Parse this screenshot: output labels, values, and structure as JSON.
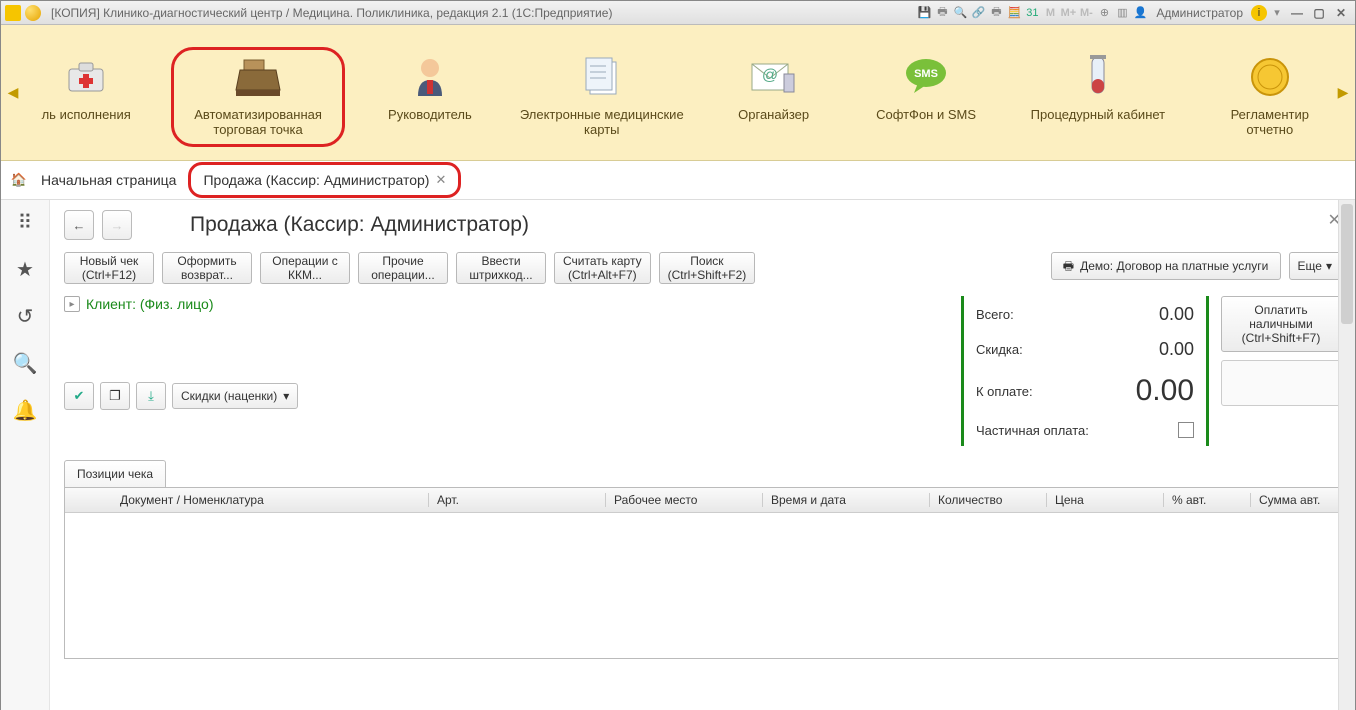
{
  "titlebar": {
    "title": "[КОПИЯ] Клинико-диагностический центр / Медицина. Поликлиника, редакция 2.1  (1С:Предприятие)",
    "user": "Администратор",
    "letters": [
      "M",
      "M+",
      "M-"
    ]
  },
  "sections": [
    {
      "label": "ль исполнения"
    },
    {
      "label": "Автоматизированная торговая точка",
      "selected": true
    },
    {
      "label": "Руководитель"
    },
    {
      "label": "Электронные медицинские карты"
    },
    {
      "label": "Органайзер"
    },
    {
      "label": "СофтФон и SMS"
    },
    {
      "label": "Процедурный кабинет"
    },
    {
      "label": "Регламентир отчетно"
    }
  ],
  "tabs": {
    "home": "Начальная страница",
    "active": "Продажа (Кассир: Администратор)"
  },
  "page": {
    "title": "Продажа (Кассир: Администратор)"
  },
  "buttons": {
    "new": {
      "l1": "Новый чек",
      "l2": "(Ctrl+F12)"
    },
    "ret": {
      "l1": "Оформить",
      "l2": "возврат..."
    },
    "kkm": {
      "l1": "Операции с",
      "l2": "ККМ..."
    },
    "other": {
      "l1": "Прочие",
      "l2": "операции..."
    },
    "bar": {
      "l1": "Ввести",
      "l2": "штрихкод..."
    },
    "card": {
      "l1": "Считать карту",
      "l2": "(Ctrl+Alt+F7)"
    },
    "search": {
      "l1": "Поиск",
      "l2": "(Ctrl+Shift+F2)"
    },
    "demo": "Демо: Договор на платные услуги",
    "more": "Еще"
  },
  "client": {
    "label": "Клиент: (Физ. лицо)"
  },
  "discounts_dd": "Скидки (наценки)",
  "totals": {
    "total_l": "Всего:",
    "total_v": "0.00",
    "disc_l": "Скидка:",
    "disc_v": "0.00",
    "due_l": "К оплате:",
    "due_v": "0.00",
    "part_l": "Частичная оплата:"
  },
  "pay": {
    "cash_l1": "Оплатить",
    "cash_l2": "наличными",
    "cash_l3": "(Ctrl+Shift+F7)"
  },
  "tabstrip": {
    "tab1": "Позиции чека"
  },
  "columns": [
    "Документ / Номенклатура",
    "Арт.",
    "Рабочее место",
    "Время и дата",
    "Количество",
    "Цена",
    "% авт.",
    "Сумма авт."
  ]
}
